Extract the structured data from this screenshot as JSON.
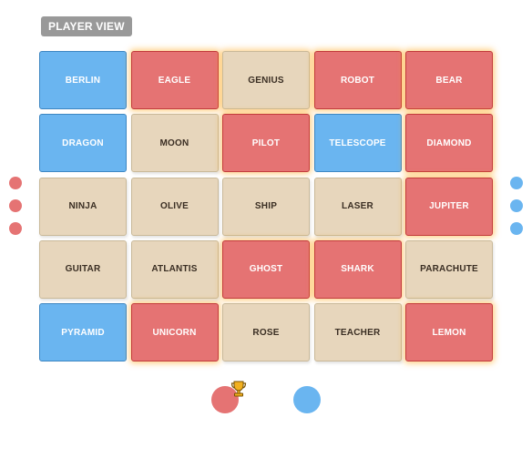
{
  "header": {
    "mode_label": "PLAYER VIEW"
  },
  "board": {
    "columns": 5,
    "cards": [
      {
        "word": "BERLIN",
        "team": "blue"
      },
      {
        "word": "EAGLE",
        "team": "red"
      },
      {
        "word": "GENIUS",
        "team": "neutral",
        "glow": true
      },
      {
        "word": "ROBOT",
        "team": "red"
      },
      {
        "word": "BEAR",
        "team": "red"
      },
      {
        "word": "DRAGON",
        "team": "blue"
      },
      {
        "word": "MOON",
        "team": "neutral"
      },
      {
        "word": "PILOT",
        "team": "red"
      },
      {
        "word": "TELESCOPE",
        "team": "blue"
      },
      {
        "word": "DIAMOND",
        "team": "red"
      },
      {
        "word": "NINJA",
        "team": "neutral"
      },
      {
        "word": "OLIVE",
        "team": "neutral"
      },
      {
        "word": "SHIP",
        "team": "neutral"
      },
      {
        "word": "LASER",
        "team": "neutral"
      },
      {
        "word": "JUPITER",
        "team": "red"
      },
      {
        "word": "GUITAR",
        "team": "neutral"
      },
      {
        "word": "ATLANTIS",
        "team": "neutral"
      },
      {
        "word": "GHOST",
        "team": "red"
      },
      {
        "word": "SHARK",
        "team": "red"
      },
      {
        "word": "PARACHUTE",
        "team": "neutral"
      },
      {
        "word": "PYRAMID",
        "team": "blue"
      },
      {
        "word": "UNICORN",
        "team": "red"
      },
      {
        "word": "ROSE",
        "team": "neutral"
      },
      {
        "word": "TEACHER",
        "team": "neutral"
      },
      {
        "word": "LEMON",
        "team": "red"
      }
    ]
  },
  "side_indicators": {
    "left": {
      "team": "red",
      "count": 3
    },
    "right": {
      "team": "blue",
      "count": 3
    }
  },
  "teams": [
    {
      "name": "red",
      "color": "#e57373",
      "winner_icon": "trophy-icon"
    },
    {
      "name": "blue",
      "color": "#6ab5f0"
    }
  ],
  "colors": {
    "blue": "#6ab5f0",
    "red": "#e57373",
    "neutral": "#e7d6bc",
    "glow": "#ffaa1e"
  }
}
